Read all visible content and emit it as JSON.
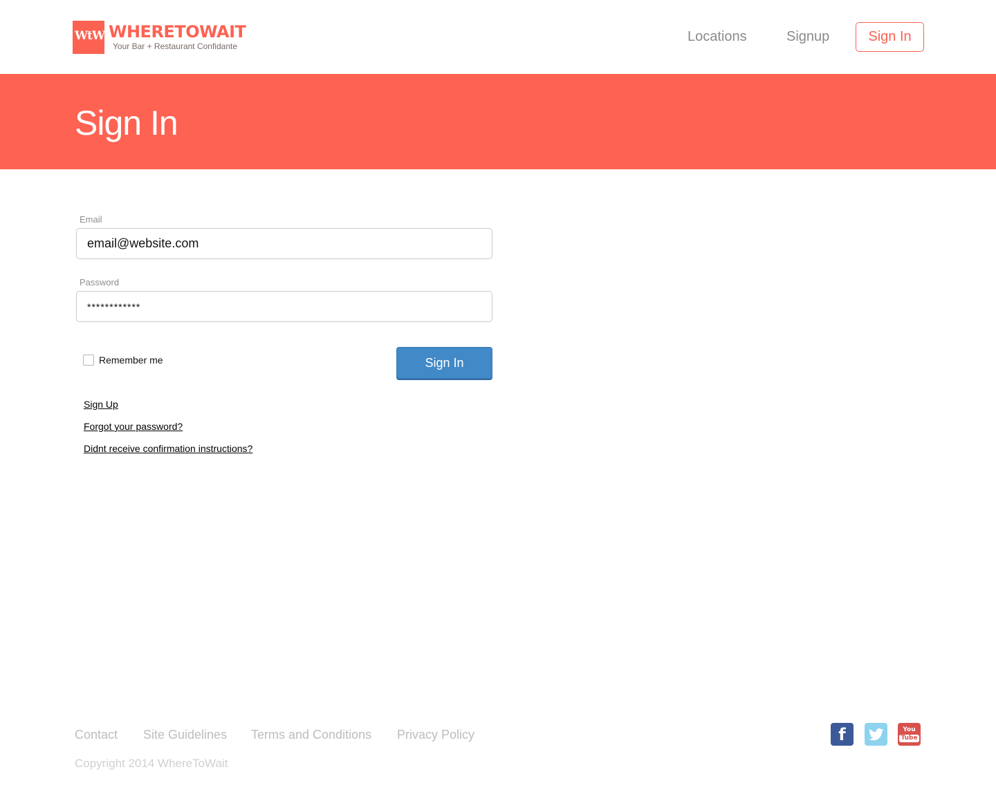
{
  "header": {
    "logo": {
      "mark_text": "WtW",
      "name": "WHERETOWAIT",
      "tagline": "Your Bar + Restaurant Confidante"
    },
    "nav": {
      "locations": "Locations",
      "signup": "Signup",
      "signin": "Sign In"
    }
  },
  "hero": {
    "title": "Sign In"
  },
  "form": {
    "email_label": "Email",
    "email_value": "email@website.com",
    "password_label": "Password",
    "password_value": "************",
    "remember_label": "Remember me",
    "remember_checked": false,
    "submit_label": "Sign In"
  },
  "links": {
    "signup": "Sign Up",
    "forgot": "Forgot your password?",
    "confirm": "Didnt receive confirmation instructions?"
  },
  "footer": {
    "links": {
      "contact": "Contact",
      "guidelines": "Site Guidelines",
      "terms": "Terms and Conditions",
      "privacy": "Privacy Policy"
    },
    "copyright": "Copyright 2014 WhereToWait",
    "social": {
      "facebook": {
        "icon": "facebook-icon",
        "glyph": "f",
        "color": "#3c5a99"
      },
      "twitter": {
        "icon": "twitter-icon",
        "color": "#8dd3f0"
      },
      "youtube": {
        "icon": "youtube-icon",
        "you": "You",
        "tube": "Tube",
        "color": "#d7524d"
      }
    }
  },
  "colors": {
    "brand_coral": "#fd6252",
    "button_blue": "#4189c7",
    "nav_gray": "#8b8b8b",
    "footer_gray": "#bdbdbd"
  }
}
